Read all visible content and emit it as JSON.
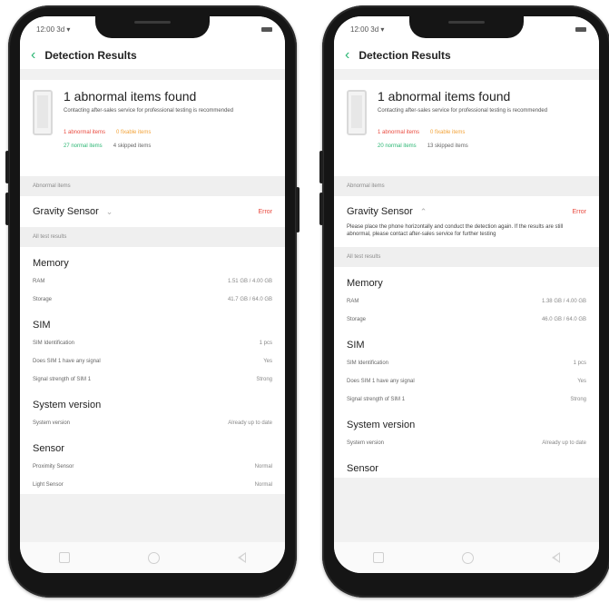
{
  "left": {
    "status_time": "12:00 3d ▾",
    "title": "Detection Results",
    "summary": {
      "headline": "1 abnormal items found",
      "description": "Contacting after-sales service for professional testing is recommended",
      "abnormal": "1 abnormal items",
      "fixable": "0 fixable items",
      "normal": "27 normal items",
      "skipped": "4 skipped items"
    },
    "abnormal_header": "Abnormal items",
    "abnormal_item": "Gravity Sensor",
    "abnormal_status": "Error",
    "all_results_header": "All test results",
    "groups": [
      {
        "title": "Memory",
        "rows": [
          {
            "label": "RAM",
            "value": "1.51 GB / 4.00 GB"
          },
          {
            "label": "Storage",
            "value": "41.7 GB / 64.0 GB"
          }
        ]
      },
      {
        "title": "SIM",
        "rows": [
          {
            "label": "SIM Identification",
            "value": "1 pcs"
          },
          {
            "label": "Does SIM 1 have any signal",
            "value": "Yes"
          },
          {
            "label": "Signal strength of SIM 1",
            "value": "Strong"
          }
        ]
      },
      {
        "title": "System version",
        "rows": [
          {
            "label": "System version",
            "value": "Already up to date"
          }
        ]
      },
      {
        "title": "Sensor",
        "rows": [
          {
            "label": "Proximity Sensor",
            "value": "Normal"
          },
          {
            "label": "Light Sensor",
            "value": "Normal"
          }
        ]
      }
    ]
  },
  "right": {
    "status_time": "12:00 3d ▾",
    "title": "Detection Results",
    "summary": {
      "headline": "1 abnormal items found",
      "description": "Contacting after-sales service for professional testing is recommended",
      "abnormal": "1 abnormal items",
      "fixable": "0 fixable items",
      "normal": "20 normal items",
      "skipped": "13 skipped items"
    },
    "abnormal_header": "Abnormal items",
    "abnormal_item": "Gravity Sensor",
    "abnormal_status": "Error",
    "abnormal_desc": "Please place the phone horizontally and conduct the detection again. If the results are still abnormal, please contact after-sales service for further testing",
    "all_results_header": "All test results",
    "groups": [
      {
        "title": "Memory",
        "rows": [
          {
            "label": "RAM",
            "value": "1.38 GB / 4.00 GB"
          },
          {
            "label": "Storage",
            "value": "46.0 GB / 64.0 GB"
          }
        ]
      },
      {
        "title": "SIM",
        "rows": [
          {
            "label": "SIM Identification",
            "value": "1 pcs"
          },
          {
            "label": "Does SIM 1 have any signal",
            "value": "Yes"
          },
          {
            "label": "Signal strength of SIM 1",
            "value": "Strong"
          }
        ]
      },
      {
        "title": "System version",
        "rows": [
          {
            "label": "System version",
            "value": "Already up to date"
          }
        ]
      },
      {
        "title": "Sensor",
        "rows": []
      }
    ]
  },
  "icons": {
    "back": "back-chevron-icon",
    "expand": "chevron-down-icon",
    "collapse": "chevron-up-icon",
    "nav_recent": "recent-apps-icon",
    "nav_home": "home-icon",
    "nav_back": "back-triangle-icon"
  },
  "colors": {
    "accent_green": "#2bb673",
    "error_red": "#e94a3f",
    "fixable_orange": "#f2a33a"
  }
}
